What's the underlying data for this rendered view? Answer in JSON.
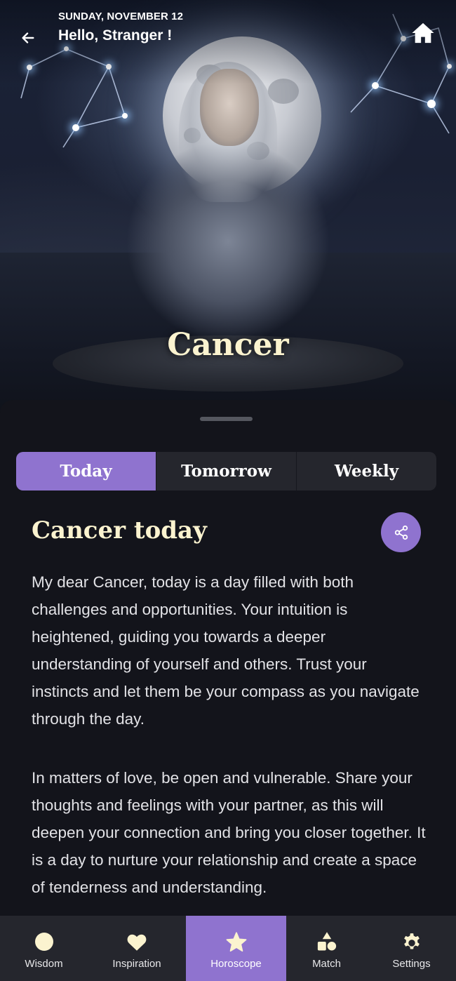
{
  "header": {
    "date": "SUNDAY, NOVEMBER 12",
    "greeting": "Hello, Stranger !",
    "back_icon": "arrow-left-icon",
    "home_icon": "home-icon"
  },
  "hero": {
    "sign_name": "Cancer"
  },
  "tabs": [
    {
      "label": "Today",
      "active": true
    },
    {
      "label": "Tomorrow",
      "active": false
    },
    {
      "label": "Weekly",
      "active": false
    }
  ],
  "content": {
    "title": "Cancer today",
    "share_icon": "share-icon",
    "paragraphs": [
      "My dear Cancer, today is a day filled with both challenges and opportunities. Your intuition is heightened, guiding you towards a deeper understanding of yourself and others. Trust your instincts and let them be your compass as you navigate through the day.",
      "In matters of love, be open and vulnerable. Share your thoughts and feelings with your partner, as this will deepen your connection and bring you closer together. It is a day to nurture your relationship and create a space of tenderness and understanding."
    ]
  },
  "nav": [
    {
      "label": "Wisdom",
      "icon": "moon-icon",
      "active": false
    },
    {
      "label": "Inspiration",
      "icon": "heart-icon",
      "active": false
    },
    {
      "label": "Horoscope",
      "icon": "star-icon",
      "active": true
    },
    {
      "label": "Match",
      "icon": "shapes-icon",
      "active": false
    },
    {
      "label": "Settings",
      "icon": "gear-icon",
      "active": false
    }
  ],
  "colors": {
    "accent": "#8f73cf",
    "title_cream": "#fbf3cf",
    "background": "#13141b",
    "surface": "#25262d"
  }
}
